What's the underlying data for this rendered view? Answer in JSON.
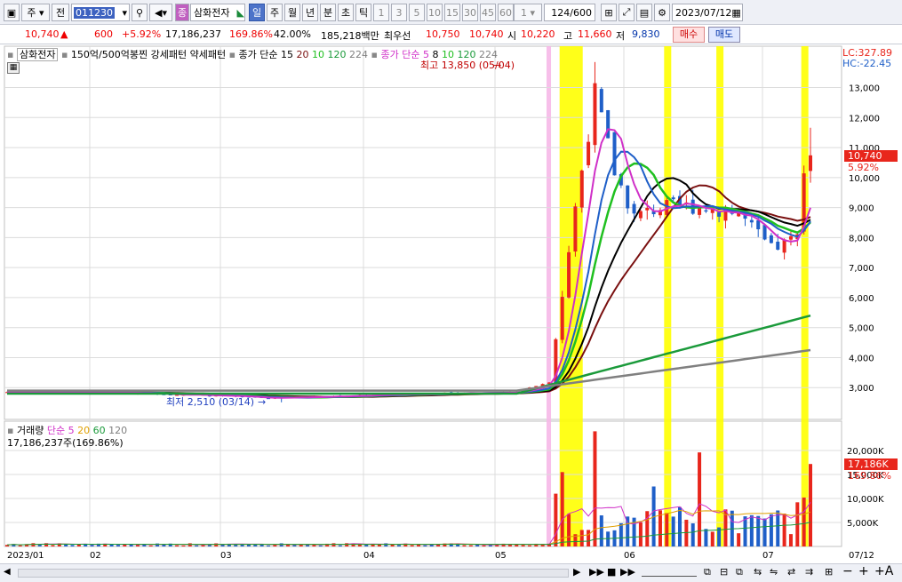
{
  "toolbar": {
    "market": "주",
    "jeon": "전",
    "stock_code": "011230",
    "jong": "종",
    "stock_name": "삼화전자",
    "periods": [
      "일",
      "주",
      "월",
      "년",
      "분",
      "초",
      "틱"
    ],
    "minute_options": [
      "1",
      "3",
      "5",
      "10",
      "15",
      "30",
      "45",
      "60"
    ],
    "interval_value": "1",
    "count": "124",
    "count_max": "/600",
    "date": "2023/07/12"
  },
  "info": {
    "price": "10,740",
    "change": "600",
    "change_pct": "+5.92%",
    "volume": "17,186,237",
    "volume_ratio": "169.86%",
    "turnover": "42.00%",
    "amount": "185,218백만",
    "best_ask_label": "최우선",
    "best_ask": "10,750",
    "best_bid": "10,740",
    "open_label": "시",
    "open": "10,220",
    "high_label": "고",
    "high": "11,660",
    "low_label": "저",
    "low": "9,830",
    "buy": "매수",
    "sell": "매도"
  },
  "price_legend": {
    "stock": "삼화전자",
    "pattern1": "150억/500억봉찐",
    "pattern2": "강세패턴",
    "pattern3": "약세패턴",
    "ma_label1": "종가 단순 15",
    "ma1": [
      "20",
      "10",
      "120",
      "224"
    ],
    "ma_label2": "종가 단순 5",
    "ma2": [
      "8",
      "10",
      "120",
      "224"
    ]
  },
  "lc_hc": {
    "lc": "LC:327.89",
    "hc": "HC:-22.45"
  },
  "annotations": {
    "max": "최고 13,850 (05/04)",
    "min": "최저 2,510 (03/14)"
  },
  "current_tag": {
    "price": "10,740",
    "pct": "5.92%"
  },
  "price_axis": [
    "13,000",
    "12,000",
    "11,000",
    "10,000",
    "9,000",
    "8,000",
    "7,000",
    "6,000",
    "5,000",
    "4,000",
    "3,000"
  ],
  "volume_legend": {
    "label": "거래량",
    "ma_label": "단순 5",
    "ma": [
      "20",
      "60",
      "120"
    ],
    "value": "17,186,237주(169.86%)"
  },
  "volume_axis": [
    "20,000K",
    "15,000K",
    "10,000K",
    "5,000K"
  ],
  "volume_tag": {
    "value": "17,186K",
    "pct": "169.86%"
  },
  "date_axis": [
    "2023/01",
    "02",
    "03",
    "04",
    "05",
    "06",
    "07",
    "07/12"
  ],
  "colors": {
    "up": "#e8261c",
    "down": "#1f5fc8",
    "ma5": "#d030c8",
    "ma10": "#1f5fc8",
    "ma15": "#000000",
    "ma20": "#7a1010",
    "ma_green": "#20c020",
    "ma120": "#1a9a3a",
    "ma224": "#808080",
    "highlight": "#ffff00",
    "highlight_pink": "#f6b8e8"
  },
  "chart_data": {
    "type": "candlestick",
    "title": "",
    "ylim": [
      2000,
      14200
    ],
    "volume_ylim": [
      0,
      25000
    ],
    "monthly_prices": [
      {
        "month": "2023/01",
        "price": 2850
      },
      {
        "month": "02",
        "price": 2820
      },
      {
        "month": "03",
        "price": 2650
      },
      {
        "month": "04",
        "price": 2830
      },
      {
        "month": "05",
        "price": 9800
      },
      {
        "month": "06",
        "price": 9000
      },
      {
        "month": "07",
        "price": 10740
      }
    ],
    "current_price": 10740,
    "current_volume": 17186,
    "high": {
      "date": "05/04",
      "price": 13850
    },
    "low": {
      "date": "03/14",
      "price": 2510
    },
    "series": [
      {
        "name": "120",
        "values": [
          2800,
          5400
        ]
      },
      {
        "name": "224",
        "values": [
          2900,
          4250
        ]
      }
    ]
  }
}
